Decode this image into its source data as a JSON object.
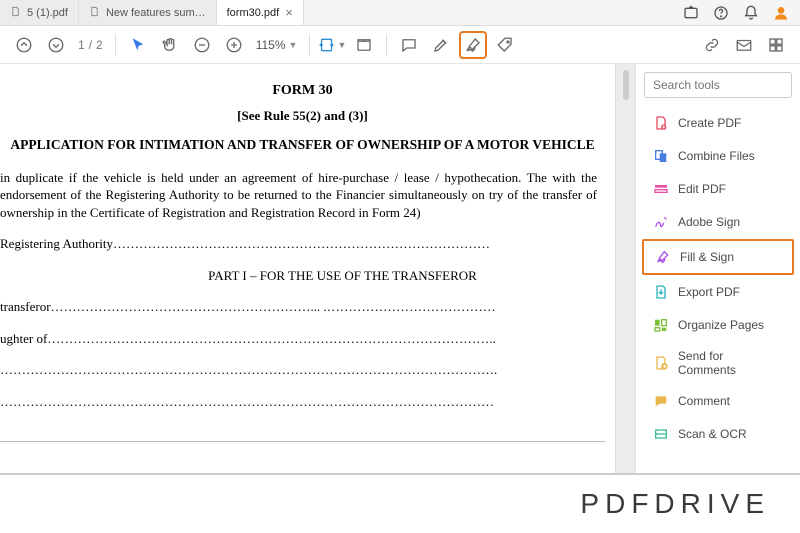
{
  "tabs": [
    {
      "label": "5 (1).pdf",
      "active": false
    },
    {
      "label": "New features sum…",
      "active": false
    },
    {
      "label": "form30.pdf",
      "active": true
    }
  ],
  "page_indicator": {
    "current": "1",
    "sep": "/",
    "total": "2"
  },
  "zoom": {
    "value": "115%"
  },
  "search": {
    "placeholder": "Search tools"
  },
  "tools": [
    {
      "key": "create",
      "label": "Create PDF",
      "color": "#e84e62"
    },
    {
      "key": "combine",
      "label": "Combine Files",
      "color": "#4a7de0"
    },
    {
      "key": "edit",
      "label": "Edit PDF",
      "color": "#e84ea6"
    },
    {
      "key": "adobesign",
      "label": "Adobe Sign",
      "color": "#b04ee8"
    },
    {
      "key": "fillsign",
      "label": "Fill & Sign",
      "color": "#a84ee8",
      "hl": true
    },
    {
      "key": "export",
      "label": "Export PDF",
      "color": "#2bb3c4"
    },
    {
      "key": "organize",
      "label": "Organize Pages",
      "color": "#7bbf3a"
    },
    {
      "key": "send",
      "label": "Send for Comments",
      "color": "#e8b74e"
    },
    {
      "key": "comment",
      "label": "Comment",
      "color": "#e8b74e"
    },
    {
      "key": "scan",
      "label": "Scan & OCR",
      "color": "#3abf9a"
    }
  ],
  "doc": {
    "title": "FORM 30",
    "subtitle": "[See Rule 55(2) and (3)]",
    "heading": "APPLICATION FOR INTIMATION AND TRANSFER OF OWNERSHIP OF A MOTOR VEHICLE",
    "para": "in duplicate if the vehicle is held under an agreement of hire-purchase / lease / hypothecation. The with the endorsement of the Registering Authority to be returned to the Financier simultaneously on try of the transfer of ownership in the Certificate of Registration and Registration Record in Form 24)",
    "line_reg": "Registering Authority……………………………………………………………………………",
    "part": "PART I – FOR THE USE OF THE TRANSFEROR",
    "line_trans": "transferor……………………………………………………... .…………………………………",
    "line_daughter": "ughter of…………………………………………………………………………………………..",
    "line_blank1": "…………………………………………………………………………………………………….",
    "line_blank2": "……………………………………………………………………………………………………"
  },
  "footer": {
    "brand": "PDFDRIVE"
  }
}
